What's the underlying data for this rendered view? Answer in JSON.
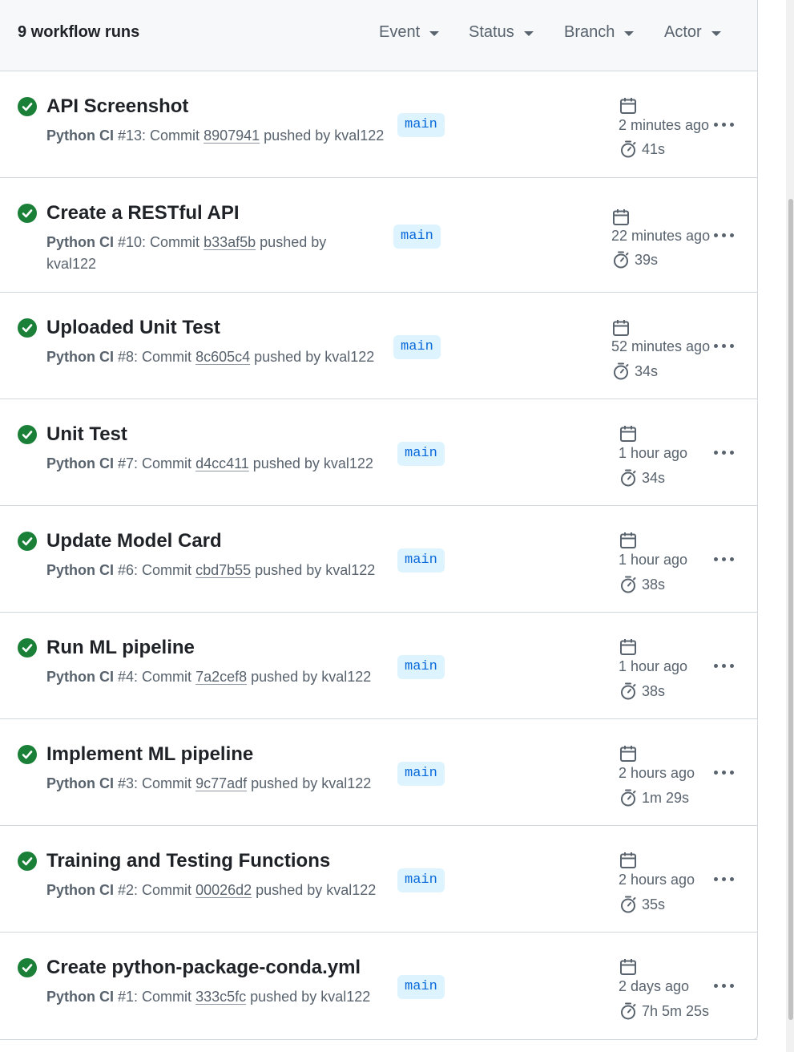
{
  "header": {
    "count_label": "9 workflow runs",
    "filters": [
      "Event",
      "Status",
      "Branch",
      "Actor"
    ]
  },
  "colors": {
    "success": "#1a7f37",
    "branch_bg": "#ddf4ff",
    "branch_fg": "#0969da"
  },
  "runs": [
    {
      "title": "API Screenshot",
      "workflow": "Python CI",
      "run_text": "#13: Commit",
      "sha": "8907941",
      "pushed_text": "pushed by kval122",
      "pushed_text_2": "",
      "branch": "main",
      "when": "2 minutes ago",
      "duration": "41s"
    },
    {
      "title": "Create a RESTful API",
      "workflow": "Python CI",
      "run_text": "#10: Commit",
      "sha": "b33af5b",
      "pushed_text": "pushed by",
      "pushed_text_2": "kval122",
      "branch": "main",
      "when": "22 minutes ago",
      "duration": "39s"
    },
    {
      "title": "Uploaded Unit Test",
      "workflow": "Python CI",
      "run_text": "#8: Commit",
      "sha": "8c605c4",
      "pushed_text": "pushed by kval122",
      "pushed_text_2": "",
      "branch": "main",
      "when": "52 minutes ago",
      "duration": "34s"
    },
    {
      "title": "Unit Test",
      "workflow": "Python CI",
      "run_text": "#7: Commit",
      "sha": "d4cc411",
      "pushed_text": "pushed by kval122",
      "pushed_text_2": "",
      "branch": "main",
      "when": "1 hour ago",
      "duration": "34s"
    },
    {
      "title": "Update Model Card",
      "workflow": "Python CI",
      "run_text": "#6: Commit",
      "sha": "cbd7b55",
      "pushed_text": "pushed by kval122",
      "pushed_text_2": "",
      "branch": "main",
      "when": "1 hour ago",
      "duration": "38s"
    },
    {
      "title": "Run ML pipeline",
      "workflow": "Python CI",
      "run_text": "#4: Commit",
      "sha": "7a2cef8",
      "pushed_text": "pushed by kval122",
      "pushed_text_2": "",
      "branch": "main",
      "when": "1 hour ago",
      "duration": "38s"
    },
    {
      "title": "Implement ML pipeline",
      "workflow": "Python CI",
      "run_text": "#3: Commit",
      "sha": "9c77adf",
      "pushed_text": "pushed by kval122",
      "pushed_text_2": "",
      "branch": "main",
      "when": "2 hours ago",
      "duration": "1m 29s"
    },
    {
      "title": "Training and Testing Functions",
      "workflow": "Python CI",
      "run_text": "#2: Commit",
      "sha": "00026d2",
      "pushed_text": "pushed by kval122",
      "pushed_text_2": "",
      "branch": "main",
      "when": "2 hours ago",
      "duration": "35s"
    },
    {
      "title": "Create python-package-conda.yml",
      "workflow": "Python CI",
      "run_text": "#1: Commit",
      "sha": "333c5fc",
      "pushed_text": "pushed by kval122",
      "pushed_text_2": "",
      "branch": "main",
      "when": "2 days ago",
      "duration": "7h 5m 25s"
    }
  ]
}
